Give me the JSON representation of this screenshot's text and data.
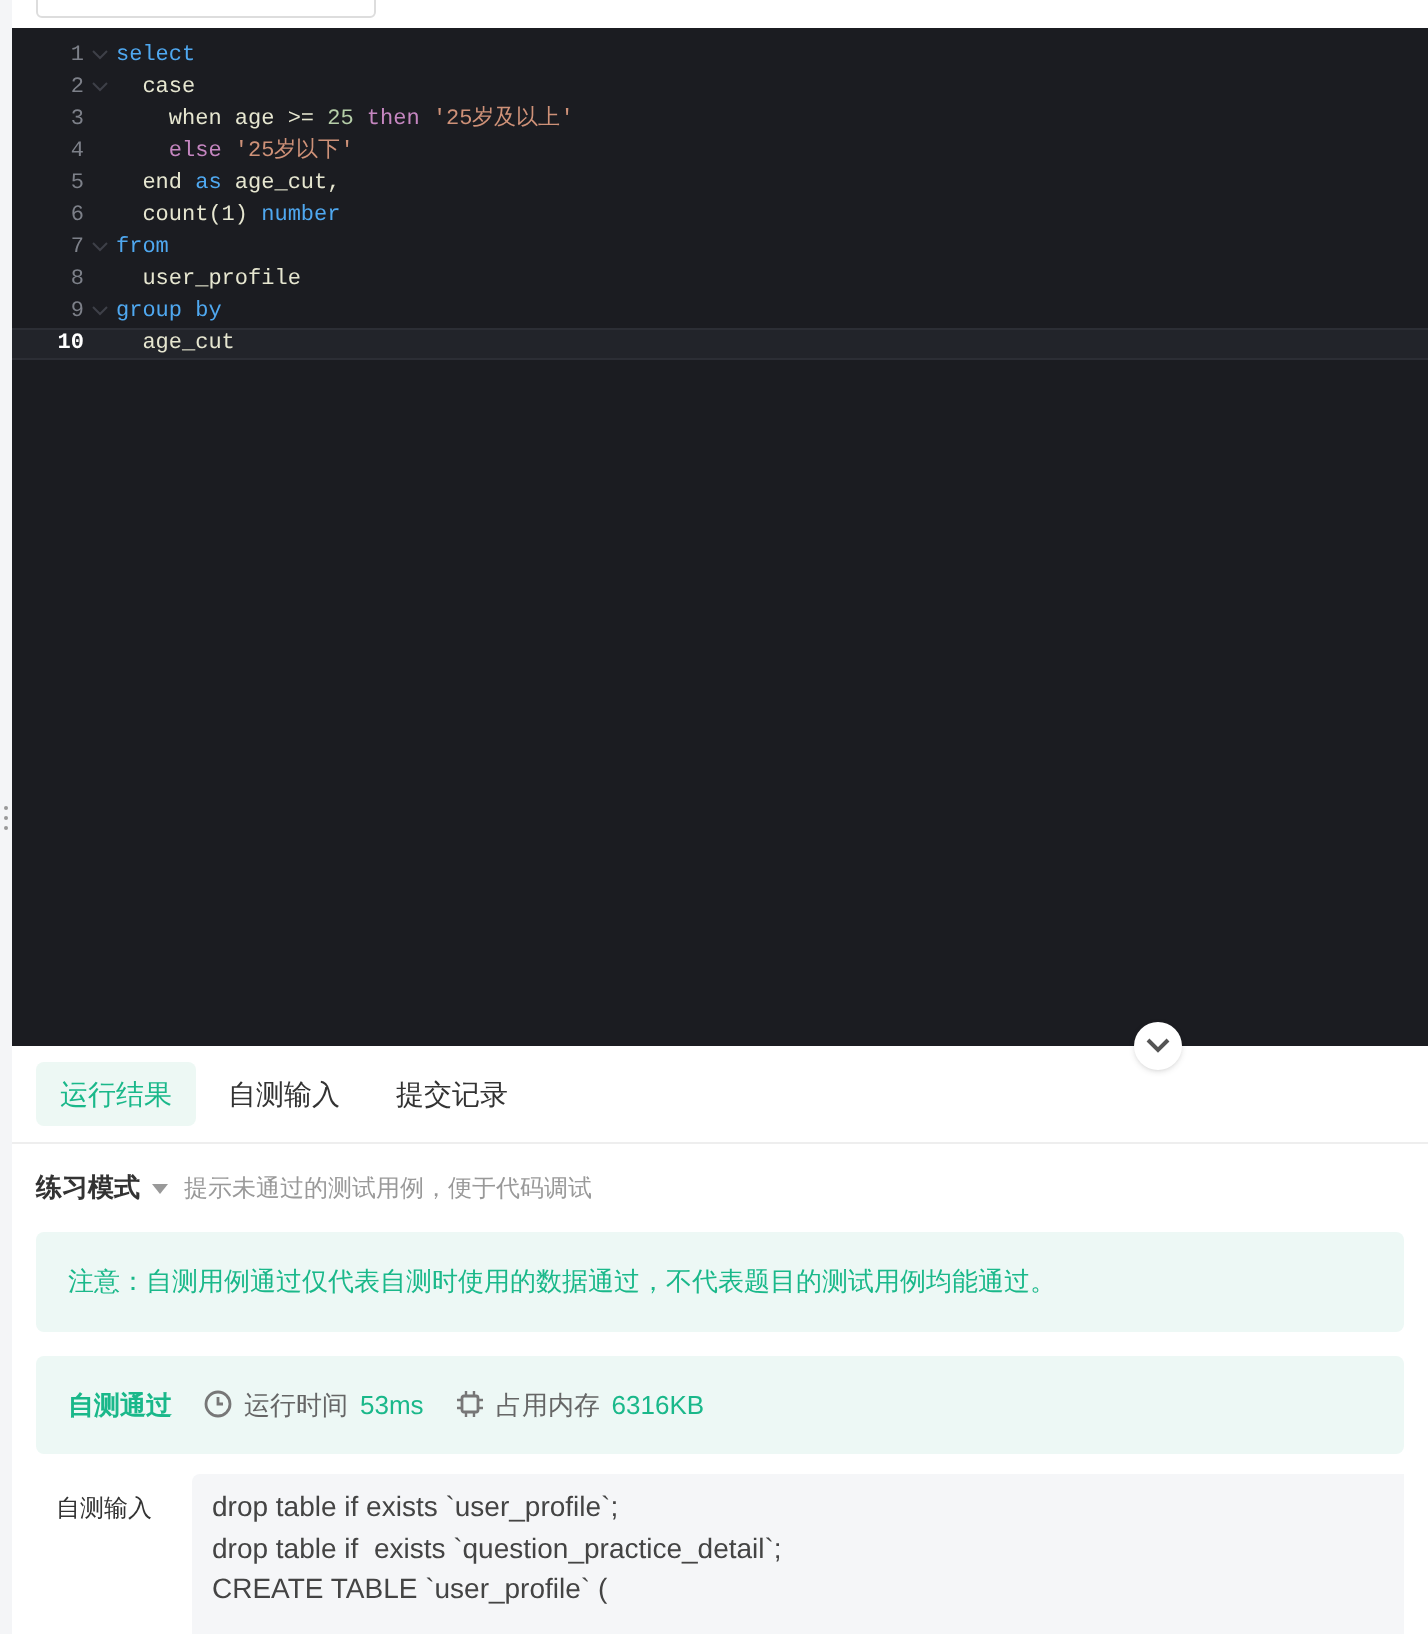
{
  "editor": {
    "lines": [
      {
        "number": "1",
        "fold": true,
        "selected": false,
        "tokens": [
          {
            "text": "select",
            "kind": "keyword"
          }
        ]
      },
      {
        "number": "2",
        "fold": true,
        "selected": false,
        "tokens": [
          {
            "text": "  case",
            "kind": "plain"
          }
        ]
      },
      {
        "number": "3",
        "fold": false,
        "selected": false,
        "tokens": [
          {
            "text": "    when age >= ",
            "kind": "plain"
          },
          {
            "text": "25",
            "kind": "number"
          },
          {
            "text": " then",
            "kind": "control"
          },
          {
            "text": " '25岁及以上'",
            "kind": "string"
          }
        ]
      },
      {
        "number": "4",
        "fold": false,
        "selected": false,
        "tokens": [
          {
            "text": "    else",
            "kind": "control"
          },
          {
            "text": " '25岁以下'",
            "kind": "string"
          }
        ]
      },
      {
        "number": "5",
        "fold": false,
        "selected": false,
        "tokens": [
          {
            "text": "  end ",
            "kind": "plain"
          },
          {
            "text": "as",
            "kind": "keyword"
          },
          {
            "text": " age_cut,",
            "kind": "plain"
          }
        ]
      },
      {
        "number": "6",
        "fold": false,
        "selected": false,
        "tokens": [
          {
            "text": "  count(1) ",
            "kind": "plain"
          },
          {
            "text": "number",
            "kind": "keyword"
          }
        ]
      },
      {
        "number": "7",
        "fold": true,
        "selected": false,
        "tokens": [
          {
            "text": "from",
            "kind": "keyword"
          }
        ]
      },
      {
        "number": "8",
        "fold": false,
        "selected": false,
        "tokens": [
          {
            "text": "  user_profile",
            "kind": "plain"
          }
        ]
      },
      {
        "number": "9",
        "fold": true,
        "selected": false,
        "tokens": [
          {
            "text": "group by",
            "kind": "keyword"
          }
        ]
      },
      {
        "number": "10",
        "fold": false,
        "selected": true,
        "tokens": [
          {
            "text": "  age_cut",
            "kind": "plain"
          }
        ]
      }
    ]
  },
  "tabs": [
    {
      "label": "运行结果",
      "selected": true
    },
    {
      "label": "自测输入",
      "selected": false
    },
    {
      "label": "提交记录",
      "selected": false
    }
  ],
  "mode": {
    "label": "练习模式",
    "hint": "提示未通过的测试用例，便于代码调试"
  },
  "notice": "注意：自测用例通过仅代表自测时使用的数据通过，不代表题目的测试用例均能通过。",
  "result": {
    "status": "自测通过",
    "time_label": "运行时间",
    "time": "53ms",
    "memory_label": "占用内存",
    "memory": "6316KB"
  },
  "input": {
    "label": "自测输入",
    "lines": [
      "drop table if exists `user_profile`;",
      "drop table if  exists `question_practice_detail`;",
      "CREATE TABLE `user_profile` ("
    ]
  }
}
